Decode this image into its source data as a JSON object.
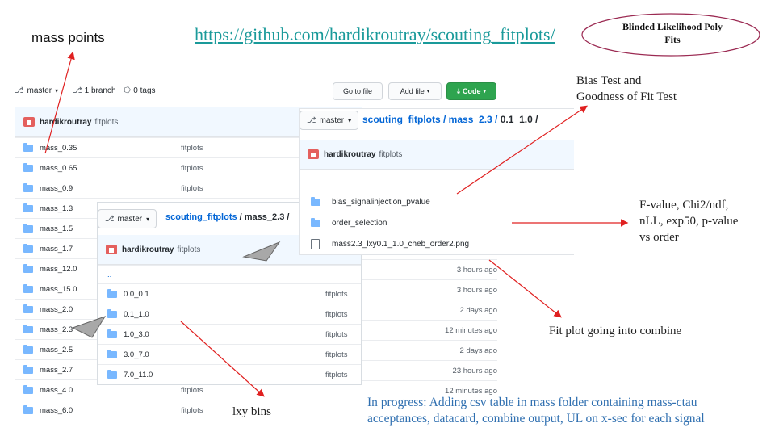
{
  "labels": {
    "mass_points": "mass points",
    "repo_url": "https://github.com/hardikroutray/scouting_fitplots/",
    "oval_title": "Blinded Likelihood Poly Fits",
    "bias_test": [
      "Bias Test and",
      "Goodness of Fit Test"
    ],
    "fvalue": [
      "F-value, Chi2/ndf,",
      "nLL, exp50, p-value",
      "vs order"
    ],
    "fit_plot": "Fit plot going into combine",
    "lxy_bins": "lxy bins",
    "in_progress": [
      "In progress: Adding csv table in mass folder containing mass-ctau",
      "acceptances, datacard, combine output, UL on x-sec for each signal"
    ]
  },
  "colors": {
    "accent": "#0366d6",
    "arrow": "#e02020",
    "green": "#2ea44f",
    "note_blue": "#2f6fb0",
    "oval": "#9b2a52"
  },
  "repo_bar": {
    "branch": "master",
    "branches": "1 branch",
    "tags": "0 tags"
  },
  "toolbar": {
    "go_to_file": "Go to file",
    "add_file": "Add file",
    "code": "Code"
  },
  "panel_main": {
    "user": "hardikroutray",
    "commit": "fitplots",
    "rows": [
      {
        "name": "mass_0.35",
        "msg": "fitplots"
      },
      {
        "name": "mass_0.65",
        "msg": "fitplots"
      },
      {
        "name": "mass_0.9",
        "msg": "fitplots"
      },
      {
        "name": "mass_1.3",
        "msg": ""
      },
      {
        "name": "mass_1.5",
        "msg": ""
      },
      {
        "name": "mass_1.7",
        "msg": ""
      },
      {
        "name": "mass_12.0",
        "msg": ""
      },
      {
        "name": "mass_15.0",
        "msg": ""
      },
      {
        "name": "mass_2.0",
        "msg": ""
      },
      {
        "name": "mass_2.3",
        "msg": ""
      },
      {
        "name": "mass_2.5",
        "msg": ""
      },
      {
        "name": "mass_2.7",
        "msg": ""
      },
      {
        "name": "mass_4.0",
        "msg": "fitplots"
      },
      {
        "name": "mass_6.0",
        "msg": "fitplots"
      }
    ]
  },
  "panel_mid": {
    "branch": "master",
    "repo": "scouting_fitplots",
    "path": " / mass_2.3 /",
    "user": "hardikroutray",
    "commit": "fitplots",
    "parent": "..",
    "rows": [
      {
        "name": "0.0_0.1",
        "msg": "fitplots"
      },
      {
        "name": "0.1_1.0",
        "msg": "fitplots"
      },
      {
        "name": "1.0_3.0",
        "msg": "fitplots"
      },
      {
        "name": "3.0_7.0",
        "msg": "fitplots"
      },
      {
        "name": "7.0_11.0",
        "msg": "fitplots"
      }
    ]
  },
  "panel_right": {
    "branch": "master",
    "repo": "scouting_fitplots",
    "path1": " / mass_2.3 / ",
    "path2": "0.1_1.0 /",
    "user": "hardikroutray",
    "commit": "fitplots",
    "parent": "..",
    "rows": [
      {
        "name": "bias_signalinjection_pvalue",
        "type": "folder"
      },
      {
        "name": "order_selection",
        "type": "folder"
      },
      {
        "name": "mass2.3_lxy0.1_1.0_cheb_order2.png",
        "type": "file"
      }
    ],
    "times": [
      "3 hours ago",
      "3 hours ago",
      "2 days ago",
      "12 minutes ago",
      "2 days ago",
      "23 hours ago",
      "12 minutes ago"
    ]
  }
}
